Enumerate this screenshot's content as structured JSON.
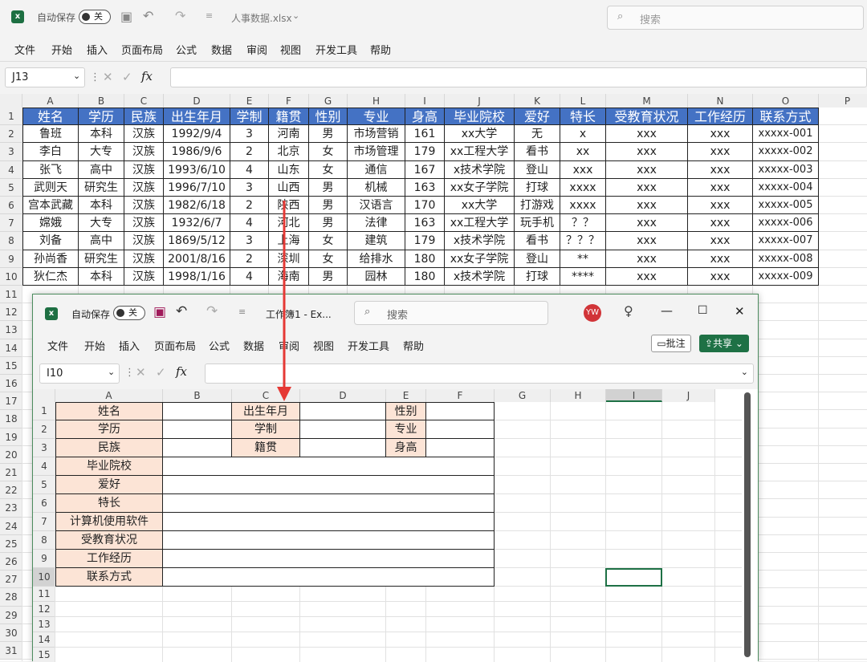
{
  "back_window": {
    "title_bar": {
      "autosave": "自动保存",
      "toggle": "关",
      "filename": "人事数据.xlsx",
      "search_placeholder": "搜索"
    },
    "menu": [
      "文件",
      "开始",
      "插入",
      "页面布局",
      "公式",
      "数据",
      "审阅",
      "视图",
      "开发工具",
      "帮助"
    ],
    "name_box": "J13",
    "columns": [
      "A",
      "B",
      "C",
      "D",
      "E",
      "F",
      "G",
      "H",
      "I",
      "J",
      "K",
      "L",
      "M",
      "N",
      "O",
      "P"
    ],
    "table_header": [
      "姓名",
      "学历",
      "民族",
      "出生年月",
      "学制",
      "籍贯",
      "性别",
      "专业",
      "身高",
      "毕业院校",
      "爱好",
      "特长",
      "受教育状况",
      "工作经历",
      "联系方式"
    ],
    "rows": [
      [
        "鲁班",
        "本科",
        "汉族",
        "1992/9/4",
        "3",
        "河南",
        "男",
        "市场营销",
        "161",
        "xx大学",
        "无",
        "x",
        "xxx",
        "xxx",
        "xxxxx-001"
      ],
      [
        "李白",
        "大专",
        "汉族",
        "1986/9/6",
        "2",
        "北京",
        "女",
        "市场管理",
        "179",
        "xx工程大学",
        "看书",
        "xx",
        "xxx",
        "xxx",
        "xxxxx-002"
      ],
      [
        "张飞",
        "高中",
        "汉族",
        "1993/6/10",
        "4",
        "山东",
        "女",
        "通信",
        "167",
        "x技术学院",
        "登山",
        "xxx",
        "xxx",
        "xxx",
        "xxxxx-003"
      ],
      [
        "武则天",
        "研究生",
        "汉族",
        "1996/7/10",
        "3",
        "山西",
        "男",
        "机械",
        "163",
        "xx女子学院",
        "打球",
        "xxxx",
        "xxx",
        "xxx",
        "xxxxx-004"
      ],
      [
        "宫本武藏",
        "本科",
        "汉族",
        "1982/6/18",
        "2",
        "陕西",
        "男",
        "汉语言",
        "170",
        "xx大学",
        "打游戏",
        "xxxx",
        "xxx",
        "xxx",
        "xxxxx-005"
      ],
      [
        "嫦娥",
        "大专",
        "汉族",
        "1932/6/7",
        "4",
        "河北",
        "男",
        "法律",
        "163",
        "xx工程大学",
        "玩手机",
        "？？",
        "xxx",
        "xxx",
        "xxxxx-006"
      ],
      [
        "刘备",
        "高中",
        "汉族",
        "1869/5/12",
        "3",
        "上海",
        "女",
        "建筑",
        "179",
        "x技术学院",
        "看书",
        "？？？",
        "xxx",
        "xxx",
        "xxxxx-007"
      ],
      [
        "孙尚香",
        "研究生",
        "汉族",
        "2001/8/16",
        "2",
        "深圳",
        "女",
        "给排水",
        "180",
        "xx女子学院",
        "登山",
        "**",
        "xxx",
        "xxx",
        "xxxxx-008"
      ],
      [
        "狄仁杰",
        "本科",
        "汉族",
        "1998/1/16",
        "4",
        "海南",
        "男",
        "园林",
        "180",
        "x技术学院",
        "打球",
        "****",
        "xxx",
        "xxx",
        "xxxxx-009"
      ]
    ],
    "row_numbers": [
      "1",
      "2",
      "3",
      "4",
      "5",
      "6",
      "7",
      "8",
      "9",
      "10",
      "11",
      "12",
      "13",
      "14",
      "15",
      "16",
      "17",
      "18",
      "19",
      "20",
      "21",
      "22",
      "23",
      "24",
      "25",
      "26",
      "27",
      "28",
      "29",
      "30",
      "31"
    ]
  },
  "front_window": {
    "title_bar": {
      "autosave": "自动保存",
      "toggle": "关",
      "filename": "工作簿1 - Ex...",
      "search_placeholder": "搜索",
      "avatar": "YW"
    },
    "menu": [
      "文件",
      "开始",
      "插入",
      "页面布局",
      "公式",
      "数据",
      "审阅",
      "视图",
      "开发工具",
      "帮助"
    ],
    "comment_btn": "批注",
    "share_btn": "共享",
    "name_box": "I10",
    "columns": [
      "A",
      "B",
      "C",
      "D",
      "E",
      "F",
      "G",
      "H",
      "I",
      "J"
    ],
    "row_numbers": [
      "1",
      "2",
      "3",
      "4",
      "5",
      "6",
      "7",
      "8",
      "9",
      "10",
      "11",
      "12",
      "13",
      "14",
      "15"
    ],
    "form": {
      "name": "姓名",
      "birth": "出生年月",
      "gender": "性别",
      "edu": "学历",
      "years": "学制",
      "major": "专业",
      "nation": "民族",
      "native": "籍贯",
      "height": "身高",
      "school": "毕业院校",
      "hobby": "爱好",
      "skill": "特长",
      "software": "计算机使用软件",
      "education": "受教育状况",
      "work": "工作经历",
      "contact": "联系方式"
    }
  },
  "accent": "#e53935"
}
